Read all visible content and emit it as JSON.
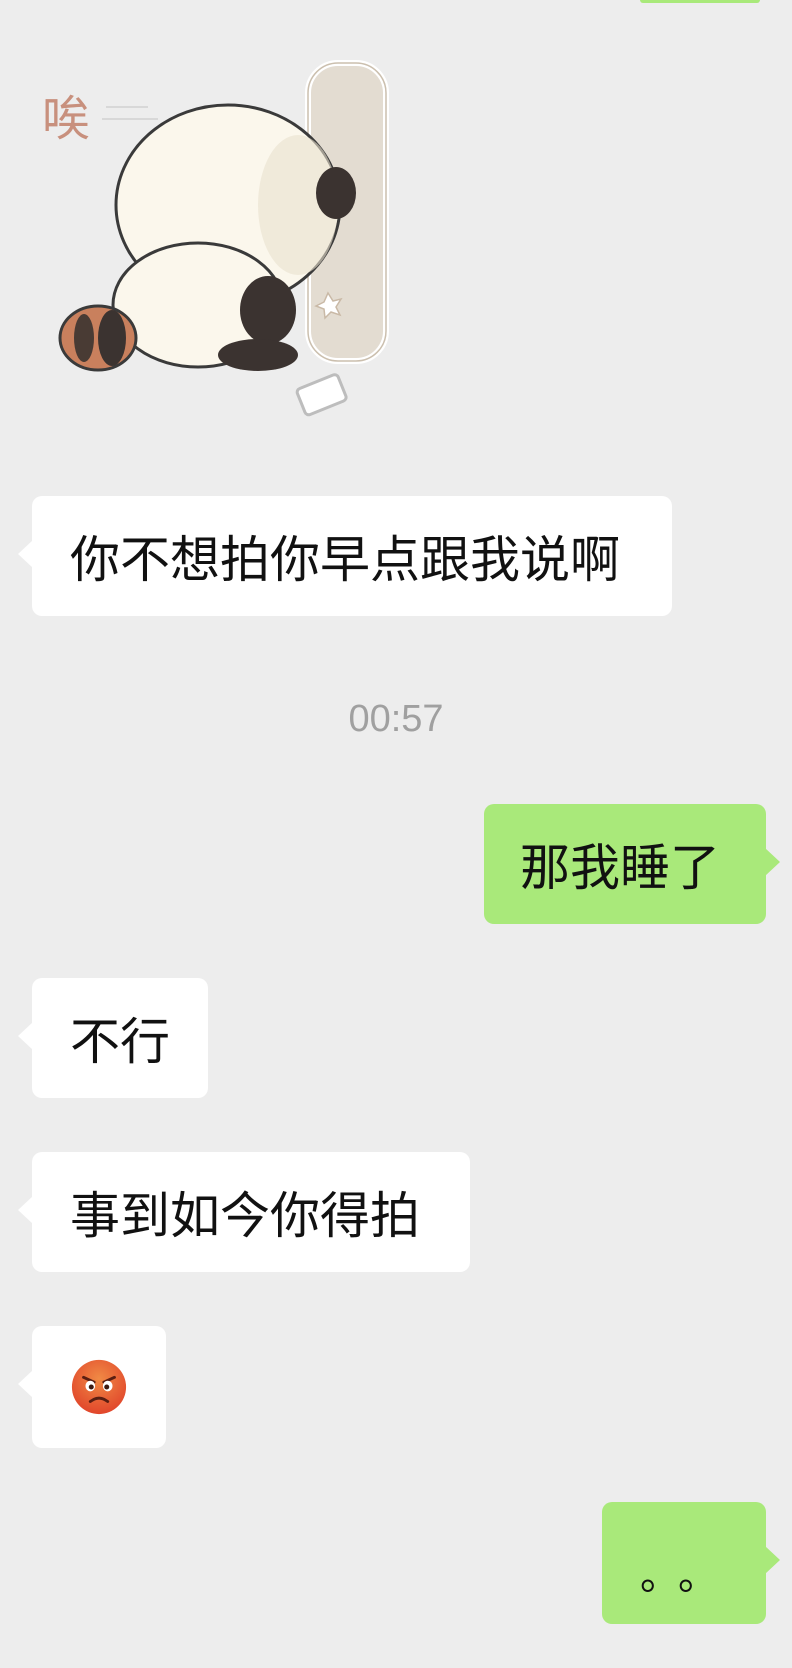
{
  "chat": {
    "sticker": {
      "icon": "sticker-raccoon-bumping-wall",
      "caption": "唉"
    },
    "messages": [
      {
        "side": "left",
        "text": "你不想拍你早点跟我说啊"
      },
      {
        "side": "right",
        "text": "那我睡了"
      },
      {
        "side": "left",
        "text": "不行"
      },
      {
        "side": "left",
        "text": "事到如今你得拍"
      },
      {
        "side": "left",
        "icon": "angry-face-emoji"
      },
      {
        "side": "right",
        "text": "。。"
      }
    ],
    "timestamp": "00:57"
  },
  "colors": {
    "background": "#ededed",
    "incoming_bubble": "#ffffff",
    "outgoing_bubble": "#a9e97a",
    "timestamp_text": "#a0a0a0"
  }
}
